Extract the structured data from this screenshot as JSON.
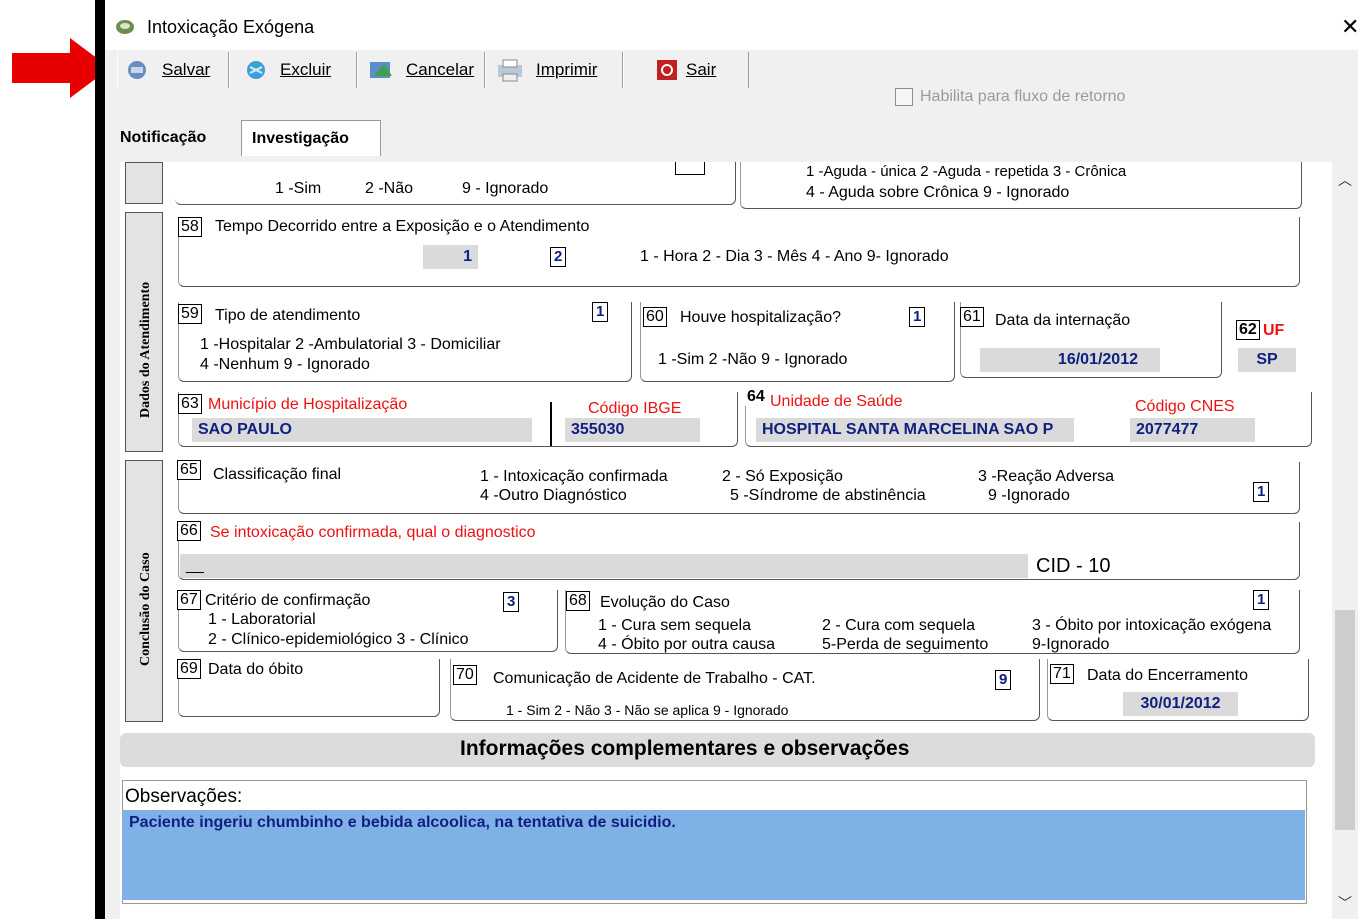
{
  "window": {
    "title": "Intoxicação Exógena",
    "close_glyph": "✕"
  },
  "toolbar": {
    "buttons": [
      {
        "label": "Salvar",
        "icon": "save-icon"
      },
      {
        "label": "Excluir",
        "icon": "delete-icon"
      },
      {
        "label": "Cancelar",
        "icon": "cancel-icon"
      },
      {
        "label": "Imprimir",
        "icon": "print-icon"
      },
      {
        "label": "Sair",
        "icon": "exit-icon"
      }
    ],
    "checkbox_label": "Habilita para fluxo de retorno"
  },
  "tabs": [
    "Notificação",
    "Investigação"
  ],
  "top_partial": {
    "left_opts": [
      "1 -Sim",
      "2 -Não",
      "9 - Ignorado"
    ],
    "right_line1": "1 -Aguda - única    2 -Aguda - repetida    3 - Crônica",
    "right_line2": "4 - Aguda sobre Crônica    9 - Ignorado"
  },
  "side_labels": {
    "atendimento": "Dados do Atendimento",
    "conclusao": "Conclusão do Caso"
  },
  "f58": {
    "num": "58",
    "label": "Tempo Decorrido entre a  Exposição e o Atendimento",
    "value": "1",
    "code": "2",
    "opts": "1 - Hora    2 - Dia    3 - Mês    4 - Ano    9- Ignorado"
  },
  "f59": {
    "num": "59",
    "label": "Tipo de atendimento",
    "code": "1",
    "line1": "1 -Hospitalar   2 -Ambulatorial     3 - Domiciliar",
    "line2": "4 -Nenhum    9 - Ignorado"
  },
  "f60": {
    "num": "60",
    "label": "Houve hospitalização?",
    "code": "1",
    "opts": "1 -Sim        2 -Não        9 - Ignorado"
  },
  "f61": {
    "num": "61",
    "label": "Data da internação",
    "value": "16/01/2012"
  },
  "f62": {
    "num": "62",
    "label": "UF",
    "value": "SP"
  },
  "f63": {
    "num": "63",
    "label": "Município de Hospitalização",
    "value": "SAO PAULO",
    "ibge_label": "Código IBGE",
    "ibge_value": "355030"
  },
  "f64": {
    "num": "64",
    "label": "Unidade de Saúde",
    "value": "HOSPITAL SANTA MARCELINA SAO P",
    "cnes_label": "Código CNES",
    "cnes_value": "2077477"
  },
  "f65": {
    "num": "65",
    "label": "Classificação final",
    "line1a": "1 - Intoxicação confirmada",
    "line1b": "2 - Só Exposição",
    "line1c": "3 -Reação Adversa",
    "line2a": "4 -Outro Diagnóstico",
    "line2b": "5 -Síndrome de abstinência",
    "line2c": "9 -Ignorado",
    "code": "1"
  },
  "f66": {
    "num": "66",
    "label": "Se intoxicação confirmada, qual o diagnostico",
    "value": "__",
    "cid_label": "CID - 10"
  },
  "f67": {
    "num": "67",
    "label": "Critério de confirmação",
    "code": "3",
    "line1": "1 - Laboratorial",
    "line2": "2 - Clínico-epidemiológico     3 - Clínico"
  },
  "f68": {
    "num": "68",
    "label": "Evolução do Caso",
    "code": "1",
    "a1": "1 - Cura sem sequela",
    "b1": "2 - Cura com sequela",
    "c1": "3 - Óbito por intoxicação exógena",
    "a2": "4 - Óbito por outra causa",
    "b2": "5-Perda de seguimento",
    "c2": "9-Ignorado"
  },
  "f69": {
    "num": "69",
    "label": "Data do óbito"
  },
  "f70": {
    "num": "70",
    "label": "Comunicação de Acidente de Trabalho - CAT.",
    "code": "9",
    "opts": "1 - Sim      2 - Não      3 - Não se aplica      9 - Ignorado"
  },
  "f71": {
    "num": "71",
    "label": "Data do Encerramento",
    "value": "30/01/2012"
  },
  "complementares": {
    "title": "Informações complementares e observações",
    "obs_label": "Observações:",
    "obs_text": "Paciente ingeriu chumbinho e bebida alcoolica, na tentativa de suicidio."
  },
  "colors": {
    "arrow": "#e60000",
    "required_label": "#e11111",
    "value_text": "#102080",
    "obs_highlight": "#7fb0e6"
  }
}
